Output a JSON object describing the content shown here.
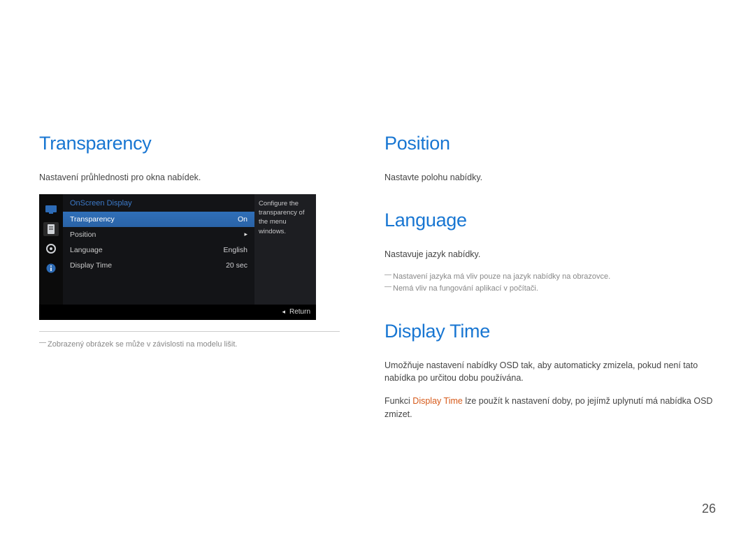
{
  "left": {
    "heading": "Transparency",
    "desc": "Nastavení průhlednosti pro okna nabídek.",
    "footnote": "Zobrazený obrázek se může v závislosti na modelu lišit."
  },
  "osd": {
    "title": "OnScreen Display",
    "rows": [
      {
        "label": "Transparency",
        "value": "On",
        "active": true
      },
      {
        "label": "Position",
        "value": "",
        "arrow": true
      },
      {
        "label": "Language",
        "value": "English"
      },
      {
        "label": "Display Time",
        "value": "20 sec"
      }
    ],
    "help": "Configure the transparency of the menu windows.",
    "return_label": "Return"
  },
  "right": {
    "position": {
      "heading": "Position",
      "desc": "Nastavte polohu nabídky."
    },
    "language": {
      "heading": "Language",
      "desc": "Nastavuje jazyk nabídky.",
      "note1": "Nastavení jazyka má vliv pouze na jazyk nabídky na obrazovce.",
      "note2": "Nemá vliv na fungování aplikací v počítači."
    },
    "displaytime": {
      "heading": "Display Time",
      "p1": "Umožňuje nastavení nabídky OSD tak, aby automaticky zmizela, pokud není tato nabídka po určitou dobu používána.",
      "p2a": "Funkci ",
      "p2b": "Display Time",
      "p2c": " lze použít k nastavení doby, po jejímž uplynutí má nabídka OSD zmizet."
    }
  },
  "page_number": "26"
}
